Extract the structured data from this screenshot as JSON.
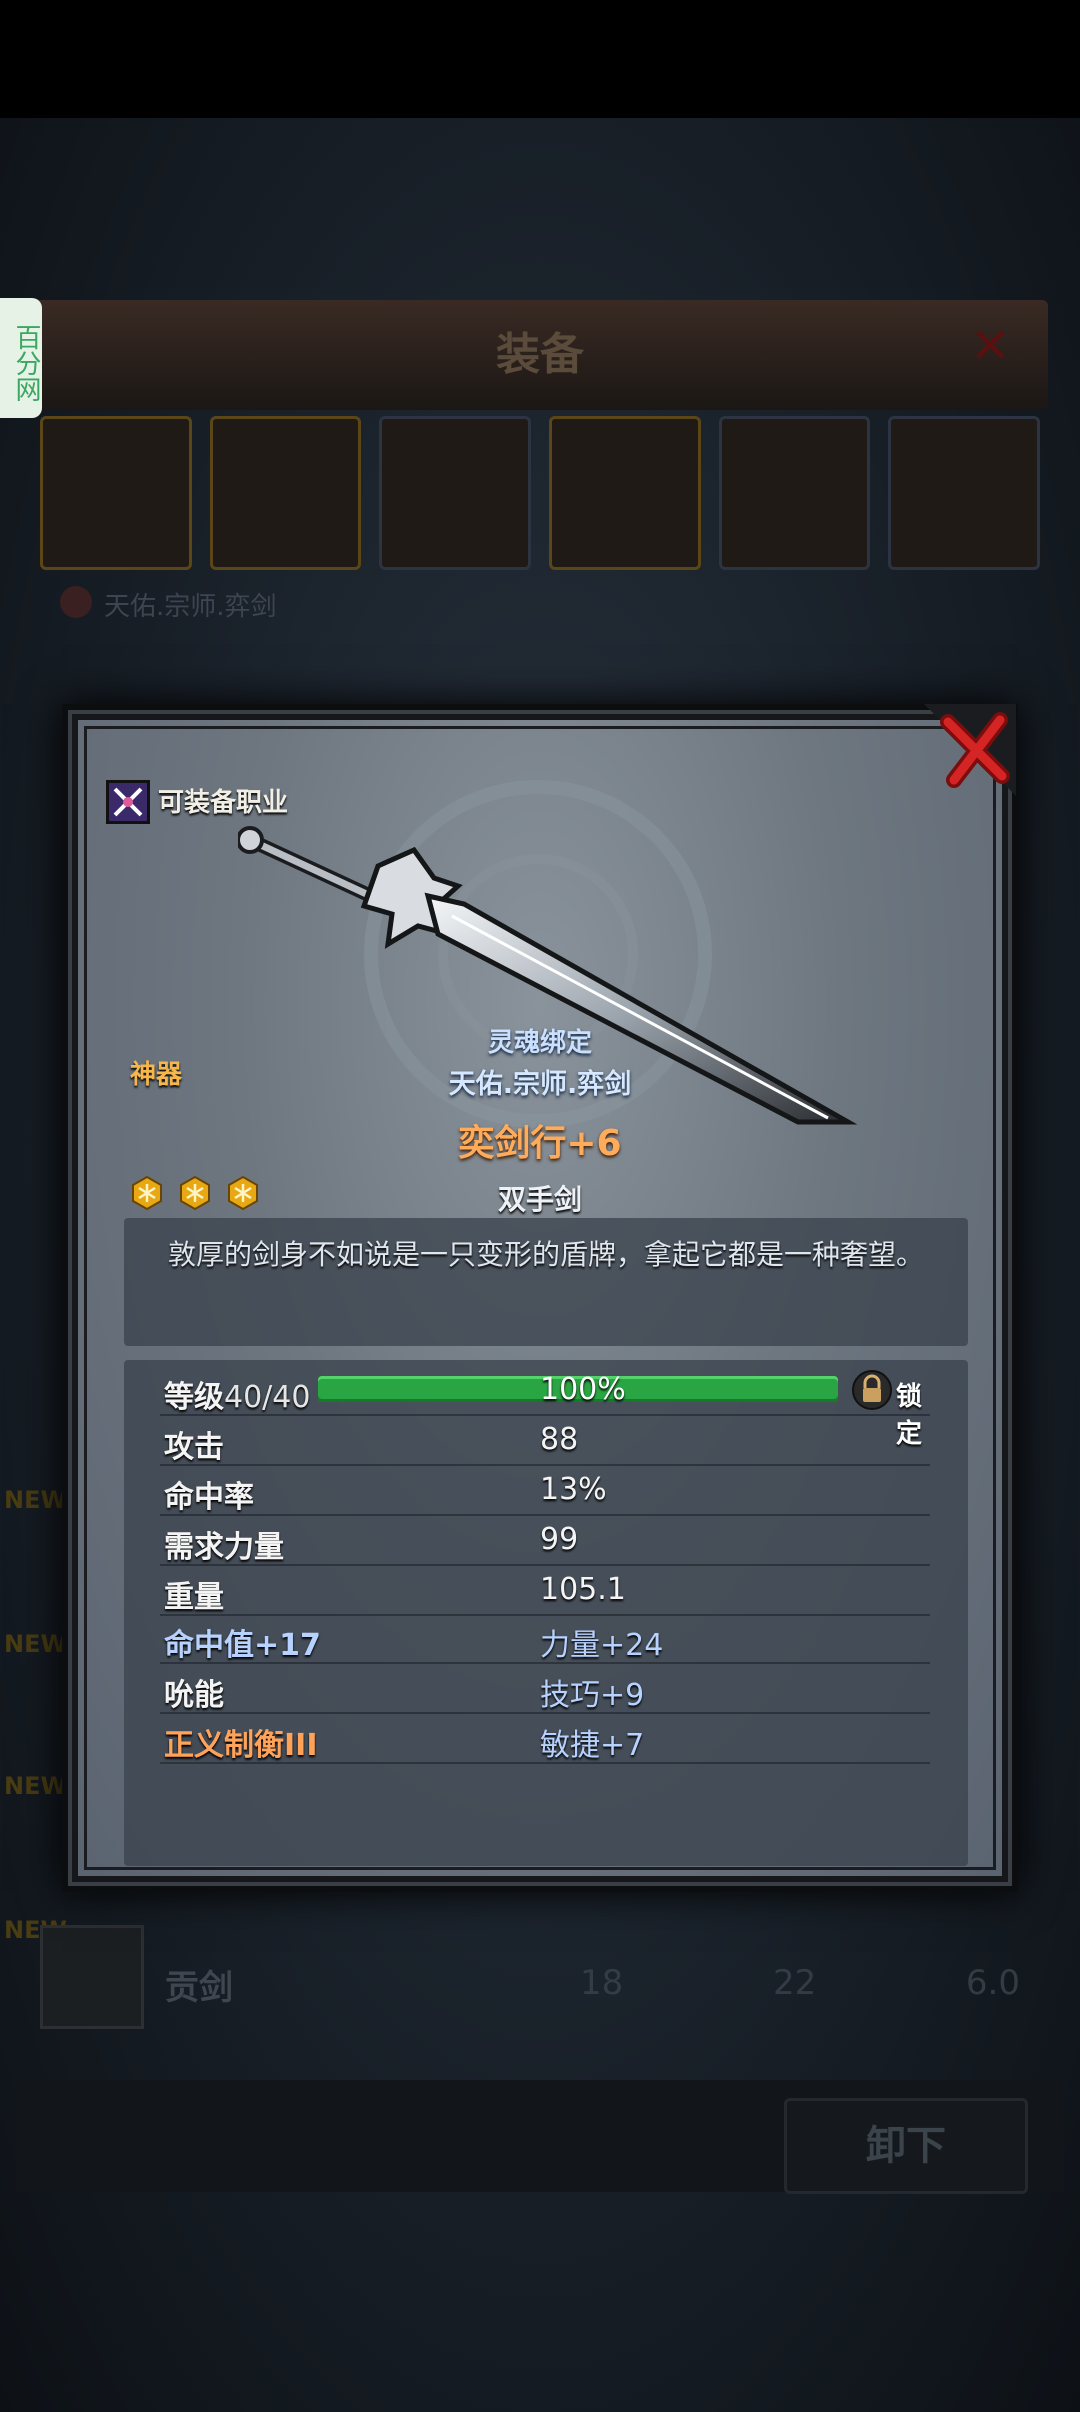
{
  "watermark": "百分网",
  "background": {
    "title": "装备",
    "owner": "天佑.宗师.弈剑",
    "new_tag": "NEW",
    "row": {
      "name": "贡剑",
      "v1": "18",
      "v2": "22",
      "v3": "6.0"
    },
    "unequip": "卸下"
  },
  "dialog": {
    "class_label": "可装备职业",
    "rarity": "神器",
    "bound": "灵魂绑定",
    "owner": "天佑.宗师.弈剑",
    "item_name": "奕剑行+6",
    "type": "双手剑",
    "stars": 3,
    "description": "敦厚的剑身不如说是一只变形的盾牌，拿起它都是一种奢望。",
    "level": {
      "label": "等级",
      "value": "40/40",
      "progress": 1.0,
      "progress_text": "100%",
      "lock_label": "锁定"
    },
    "stats": [
      {
        "label": "攻击",
        "value": "88"
      },
      {
        "label": "命中率",
        "value": "13%"
      },
      {
        "label": "需求力量",
        "value": "99"
      },
      {
        "label": "重量",
        "value": "105.1"
      }
    ],
    "bonus": [
      {
        "left": "命中值+17",
        "right": "力量+24"
      },
      {
        "left": "吮能",
        "right": "技巧+9"
      },
      {
        "left": "正义制衡III",
        "right": "敏捷+7"
      }
    ]
  },
  "colors": {
    "rarity": "#f5b74c",
    "item_name": "#ffab5c",
    "bonus_blue": "#b7d2ff",
    "skill_orange": "#ffa35a",
    "bar_green": "#2aa543"
  }
}
